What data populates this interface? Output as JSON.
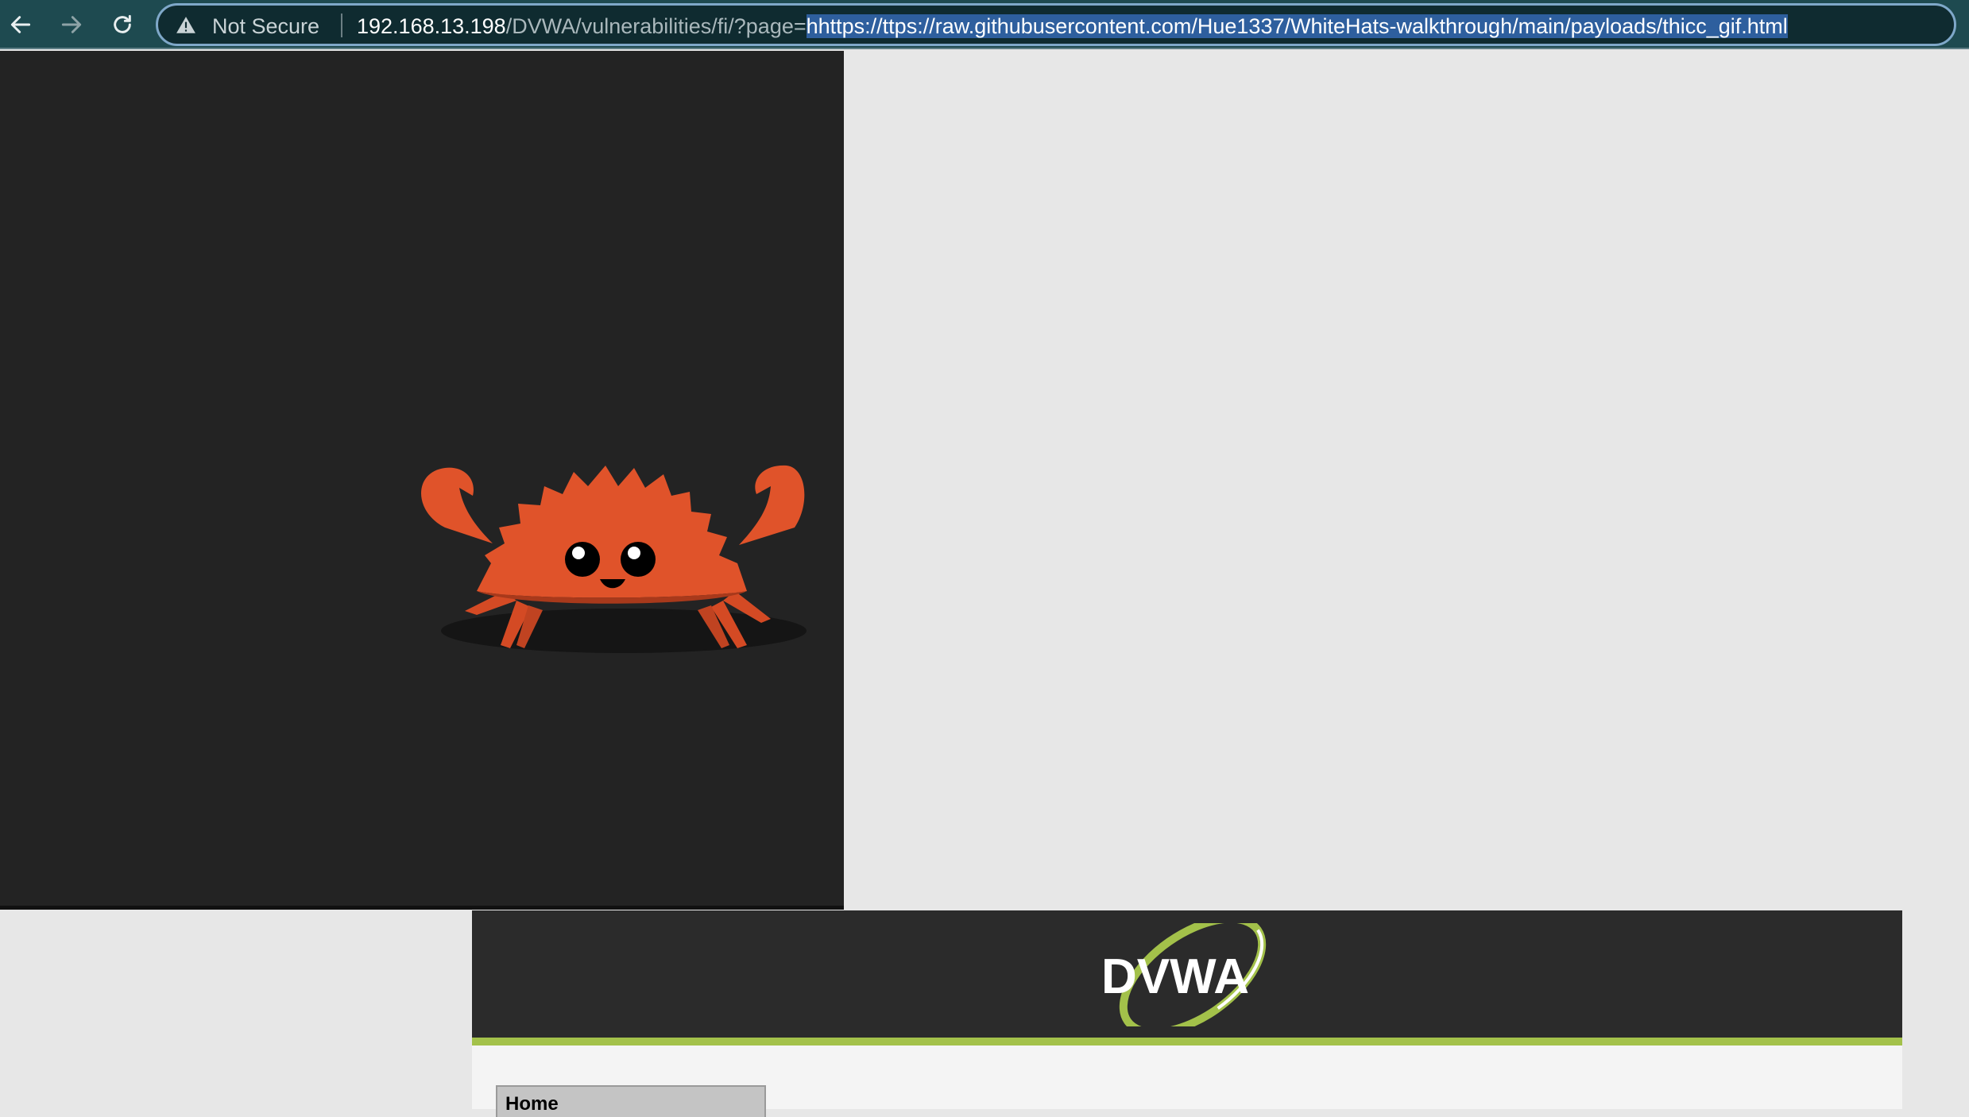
{
  "browser": {
    "security_label": "Not Secure",
    "url_host": "192.168.13.198",
    "url_path": "/DVWA/vulnerabilities/fi/?page=",
    "url_selected": "hhttps://ttps://raw.githubusercontent.com/Hue1337/WhiteHats-walkthrough/main/payloads/thicc_gif.html"
  },
  "dvwa": {
    "logo_text": "DVWA",
    "menu": {
      "home_label": "Home"
    }
  },
  "colors": {
    "toolbar_bg": "#1e4a50",
    "gif_bg": "#232323",
    "crab": "#e0532a",
    "dvwa_header": "#2b2b2b",
    "dvwa_accent": "#a3c14a"
  }
}
